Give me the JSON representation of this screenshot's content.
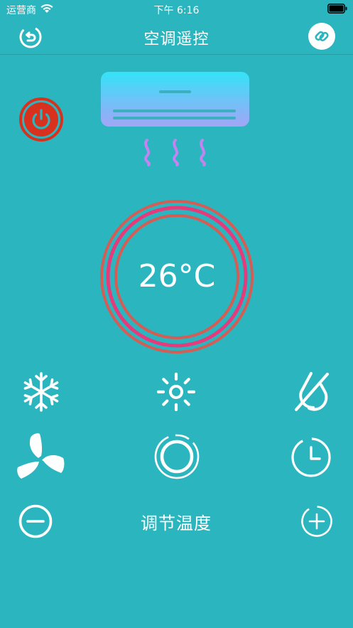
{
  "status_bar": {
    "carrier": "运营商",
    "time": "下午 6:16"
  },
  "nav": {
    "title": "空调遥控",
    "back_icon": "back-icon",
    "link_icon": "link-icon"
  },
  "controls": {
    "power_icon": "power-icon",
    "temperature": "26°C",
    "modes_row1": [
      "snowflake-icon",
      "sun-icon",
      "dry-mode-icon"
    ],
    "modes_row2": [
      "fan-icon",
      "ring-icon",
      "timer-icon"
    ],
    "adjust_label": "调节温度",
    "minus_icon": "minus-icon",
    "plus_icon": "plus-icon"
  },
  "colors": {
    "background": "#2BB5BE",
    "power_red": "#D8321E",
    "dial_outer": "#D45D55",
    "dial_accent": "#E63A7A",
    "ac_gradient_top": "#34E3F7",
    "ac_gradient_bottom": "#A3A5F7",
    "heat_waves": "#C583F1"
  }
}
